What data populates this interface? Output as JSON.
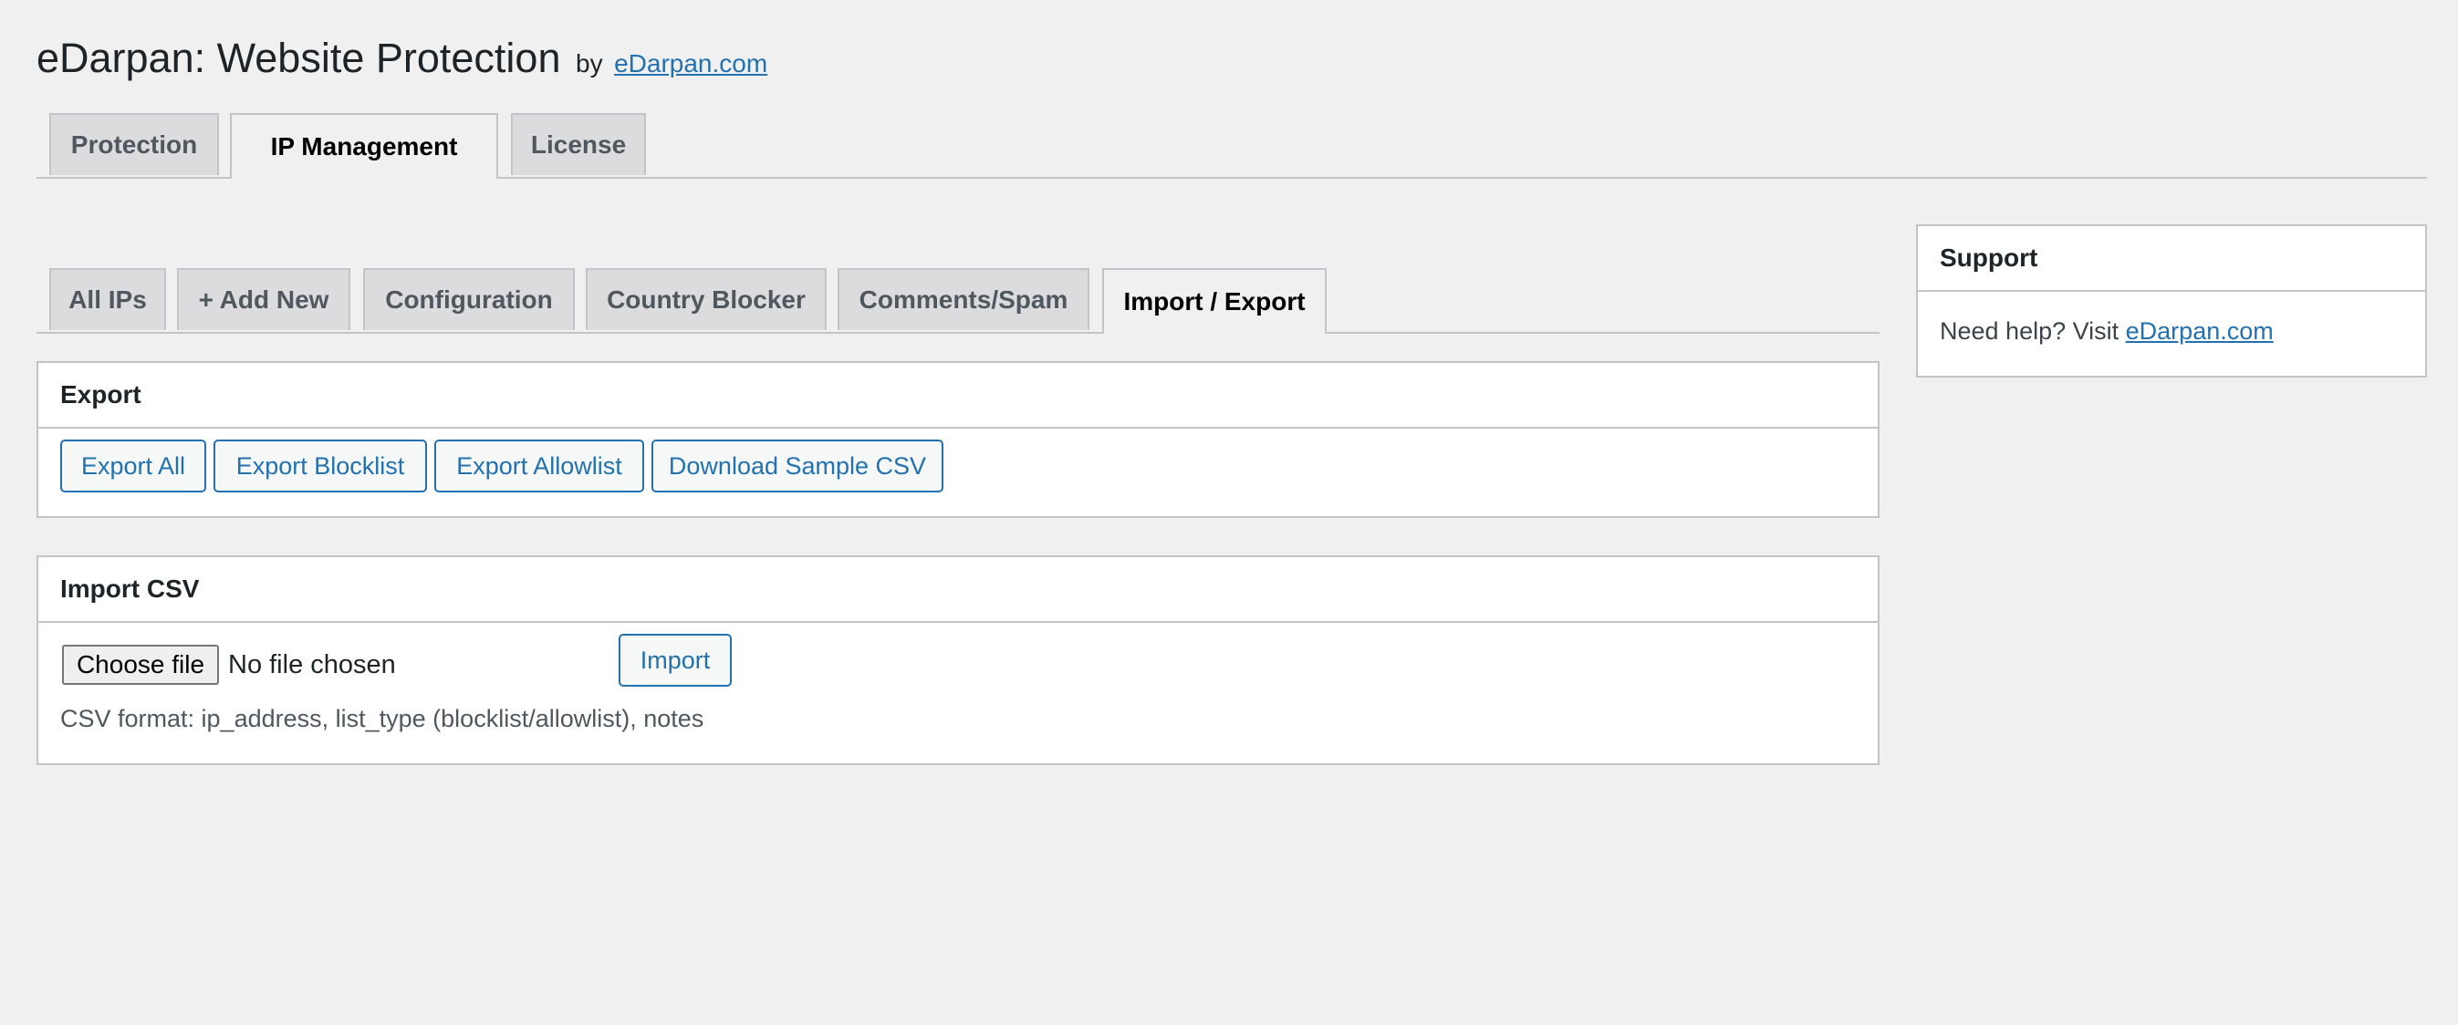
{
  "header": {
    "title": "eDarpan: Website Protection",
    "by": "by",
    "link": "eDarpan.com"
  },
  "top_tabs": [
    {
      "label": "Protection",
      "active": false
    },
    {
      "label": "IP Management",
      "active": true
    },
    {
      "label": "License",
      "active": false
    }
  ],
  "sub_tabs": [
    {
      "label": "All IPs",
      "active": false
    },
    {
      "label": "+ Add New",
      "active": false
    },
    {
      "label": "Configuration",
      "active": false
    },
    {
      "label": "Country Blocker",
      "active": false
    },
    {
      "label": "Comments/Spam",
      "active": false
    },
    {
      "label": "Import / Export",
      "active": true
    }
  ],
  "export": {
    "title": "Export",
    "buttons": [
      "Export All",
      "Export Blocklist",
      "Export Allowlist",
      "Download Sample CSV"
    ]
  },
  "import": {
    "title": "Import CSV",
    "choose_file": "Choose file",
    "file_status": "No file chosen",
    "import_button": "Import",
    "format_note": "CSV format: ip_address, list_type (blocklist/allowlist), notes"
  },
  "support": {
    "title": "Support",
    "text": "Need help? Visit",
    "link": "eDarpan.com"
  },
  "colors": {
    "background": "#f0f0f1",
    "link": "#2271b1",
    "tab_inactive": "#dcdcde",
    "border": "#c3c4c7"
  }
}
